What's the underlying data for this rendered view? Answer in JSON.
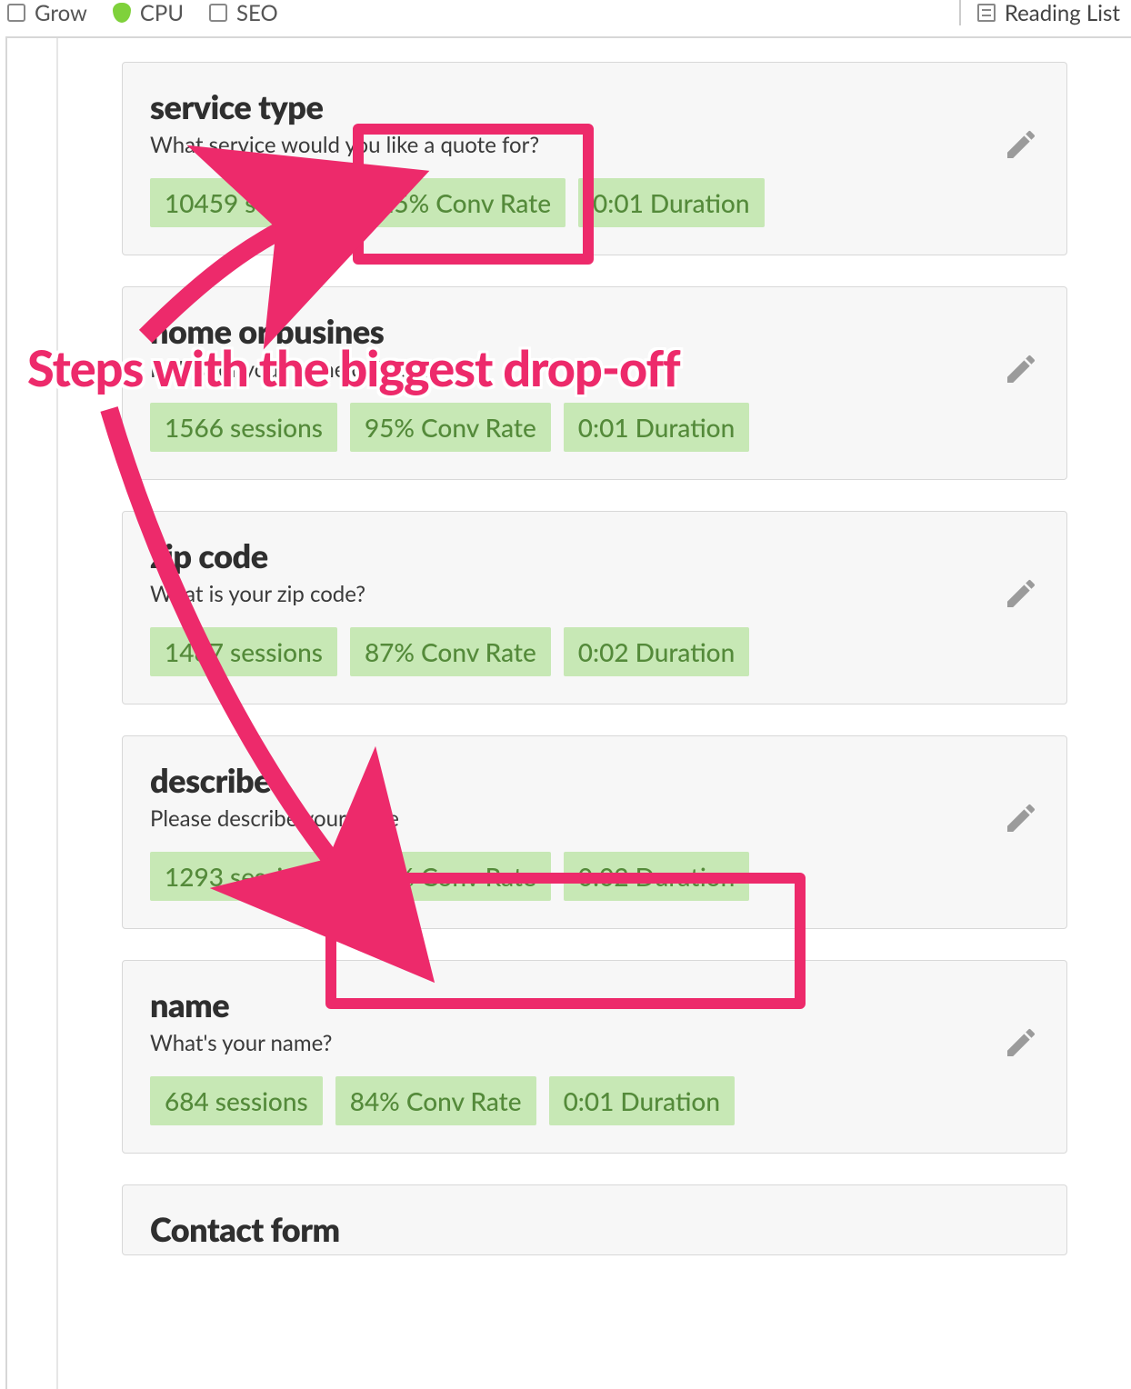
{
  "topbar": {
    "bookmarks": [
      {
        "label": "Grow"
      },
      {
        "label": "CPU"
      },
      {
        "label": "SEO"
      }
    ],
    "reading_list": "Reading List"
  },
  "cards": [
    {
      "title": "service type",
      "subtitle": "What service would you like a quote for?",
      "sessions": "10459 sessions",
      "conv": "15% Conv Rate",
      "duration": "0:01 Duration"
    },
    {
      "title": "home or busines",
      "subtitle": "Is this for your home or business?",
      "sessions": "1566 sessions",
      "conv": "95% Conv Rate",
      "duration": "0:01 Duration"
    },
    {
      "title": "zip code",
      "subtitle": "What is your zip code?",
      "sessions": "1487 sessions",
      "conv": "87% Conv Rate",
      "duration": "0:02 Duration"
    },
    {
      "title": "describe",
      "subtitle": "Please describe your issue",
      "sessions": "1293 sessions",
      "conv": "53% Conv Rate",
      "duration": "0:02 Duration"
    },
    {
      "title": "name",
      "subtitle": "What's your name?",
      "sessions": "684 sessions",
      "conv": "84% Conv Rate",
      "duration": "0:01 Duration"
    },
    {
      "title": "Contact form",
      "subtitle": "",
      "sessions": "",
      "conv": "",
      "duration": ""
    }
  ],
  "annotation": {
    "label": "Steps with the biggest drop-off"
  }
}
